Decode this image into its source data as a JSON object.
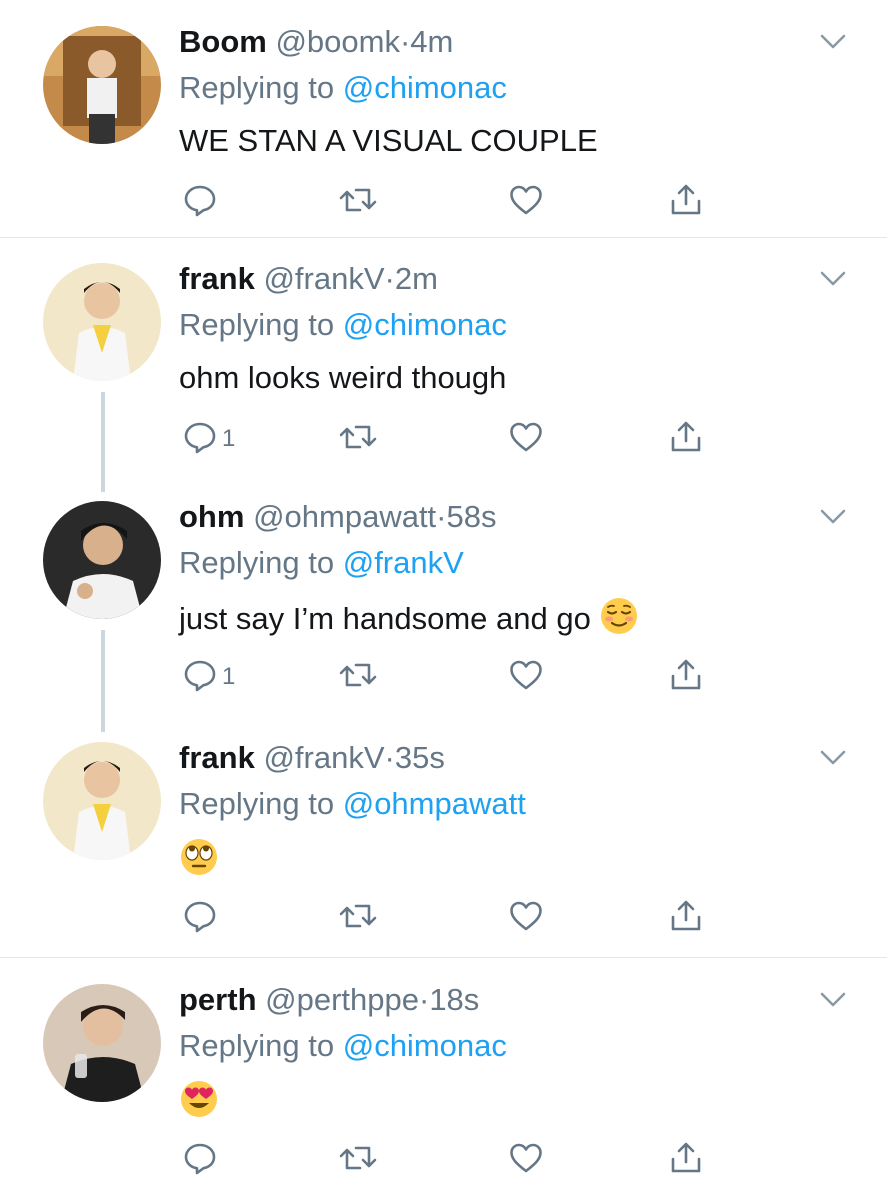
{
  "colors": {
    "link": "#1da1f2",
    "muted": "#657786",
    "divider": "#e1e8ed",
    "thread": "#ccd6dd"
  },
  "tweets": [
    {
      "name": "Boom",
      "handle": "@boomk",
      "dot": "·",
      "time": "4m",
      "replying_prefix": "Replying to ",
      "replying_to": "@chimonac",
      "text": "WE STAN A VISUAL COUPLE",
      "reply_count": ""
    },
    {
      "name": "frank",
      "handle": "@frankV",
      "dot": "·",
      "time": "2m",
      "replying_prefix": "Replying to ",
      "replying_to": "@chimonac",
      "text": "ohm looks weird though",
      "reply_count": "1"
    },
    {
      "name": "ohm",
      "handle": "@ohmpawatt",
      "dot": "·",
      "time": "58s",
      "replying_prefix": "Replying to ",
      "replying_to": "@frankV",
      "text": "just say I’m handsome and go",
      "emoji": "relieved-face-emoji",
      "reply_count": "1"
    },
    {
      "name": "frank",
      "handle": "@frankV",
      "dot": "·",
      "time": "35s",
      "replying_prefix": "Replying to ",
      "replying_to": "@ohmpawatt",
      "text": "",
      "emoji": "eye-roll-face-emoji",
      "reply_count": ""
    },
    {
      "name": "perth",
      "handle": "@perthppe",
      "dot": "·",
      "time": "18s",
      "replying_prefix": "Replying to ",
      "replying_to": "@chimonac",
      "text": "",
      "emoji": "heart-eyes-face-emoji",
      "reply_count": ""
    }
  ],
  "icons": {
    "reply": "reply-icon",
    "retweet": "retweet-icon",
    "like": "like-icon",
    "share": "share-icon",
    "more": "chevron-down-icon"
  }
}
